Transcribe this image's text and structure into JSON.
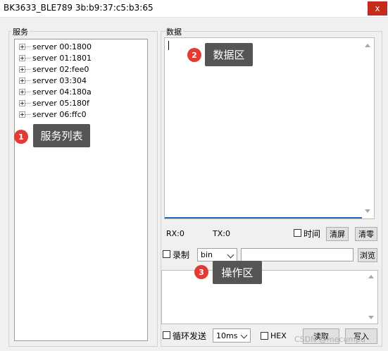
{
  "window": {
    "title": "BK3633_BLE789 3b:b9:37:c5:b3:65",
    "close_glyph": "x"
  },
  "services": {
    "group_label": "服务",
    "items": [
      "server 00:1800",
      "server 01:1801",
      "server 02:fee0",
      "server 03:304",
      "server 04:180a",
      "server 05:180f",
      "server 06:ffc0"
    ]
  },
  "data_panel": {
    "group_label": "数据",
    "rx_label": "RX:0",
    "tx_label": "TX:0",
    "time_checkbox": "时间",
    "clear_screen": "清屏",
    "clear_zero": "清零"
  },
  "record": {
    "checkbox_label": "录制",
    "format_value": "bin",
    "path_value": "",
    "browse": "浏览"
  },
  "send": {
    "loop_checkbox": "循环发送",
    "interval_value": "10ms",
    "hex_checkbox": "HEX",
    "read": "读取",
    "write": "写入"
  },
  "annotations": [
    {
      "number": "1",
      "label": "服务列表"
    },
    {
      "number": "2",
      "label": "数据区"
    },
    {
      "number": "3",
      "label": "操作区"
    }
  ],
  "watermark": "CSDN @mecumpu",
  "colors": {
    "close_bg": "#c42b1c",
    "badge": "#e53935",
    "callout": "#555555",
    "focus_line": "#1f6fbf"
  }
}
